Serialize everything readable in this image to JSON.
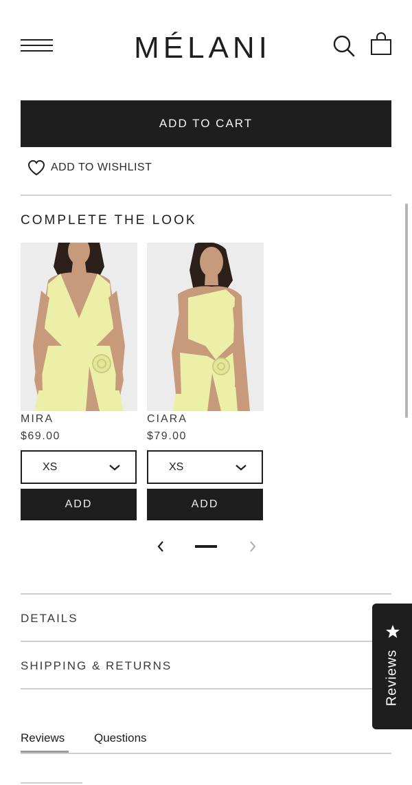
{
  "header": {
    "logo": "MÉLANI"
  },
  "purchase": {
    "add_to_cart_label": "ADD TO CART",
    "wishlist_label": "ADD TO WISHLIST"
  },
  "complete_the_look": {
    "title": "COMPLETE THE LOOK",
    "products": [
      {
        "name": "MIRA",
        "price": "$69.00",
        "size": "XS",
        "add_label": "ADD",
        "dress_color": "#ecefa7"
      },
      {
        "name": "CIARA",
        "price": "$79.00",
        "size": "XS",
        "add_label": "ADD",
        "dress_color": "#ecefa7"
      }
    ]
  },
  "accordion": {
    "details_label": "DETAILS",
    "shipping_label": "SHIPPING & RETURNS"
  },
  "reviews_widget": {
    "label": "Reviews",
    "icon": "star-icon"
  },
  "tabs": [
    {
      "label": "Reviews",
      "active": true
    },
    {
      "label": "Questions",
      "active": false
    }
  ],
  "colors": {
    "primary": "#1e1e1e",
    "divider": "#cfcfcf",
    "dress": "#ecefa7"
  }
}
